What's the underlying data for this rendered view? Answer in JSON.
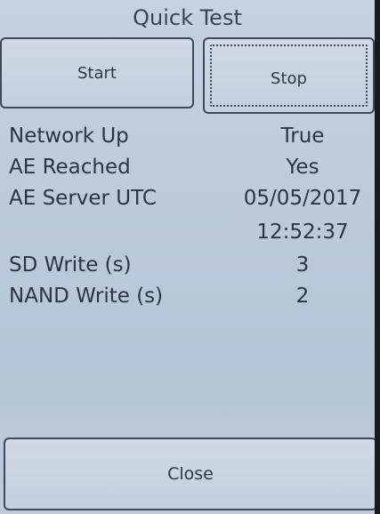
{
  "dialog": {
    "title": "Quick Test"
  },
  "buttons": {
    "start_label": "Start",
    "stop_label": "Stop",
    "close_label": "Close"
  },
  "results": [
    {
      "label": "Network Up",
      "value": "True"
    },
    {
      "label": "AE Reached",
      "value": "Yes"
    },
    {
      "label": "AE Server UTC",
      "value": "05/05/2017"
    },
    {
      "label": "",
      "value": "12:52:37"
    },
    {
      "label": "SD Write (s)",
      "value": "3"
    },
    {
      "label": "NAND Write (s)",
      "value": "2"
    }
  ],
  "colors": {
    "background": "#bccadb",
    "button_border": "#3e4a5a",
    "text": "#2c3542"
  }
}
